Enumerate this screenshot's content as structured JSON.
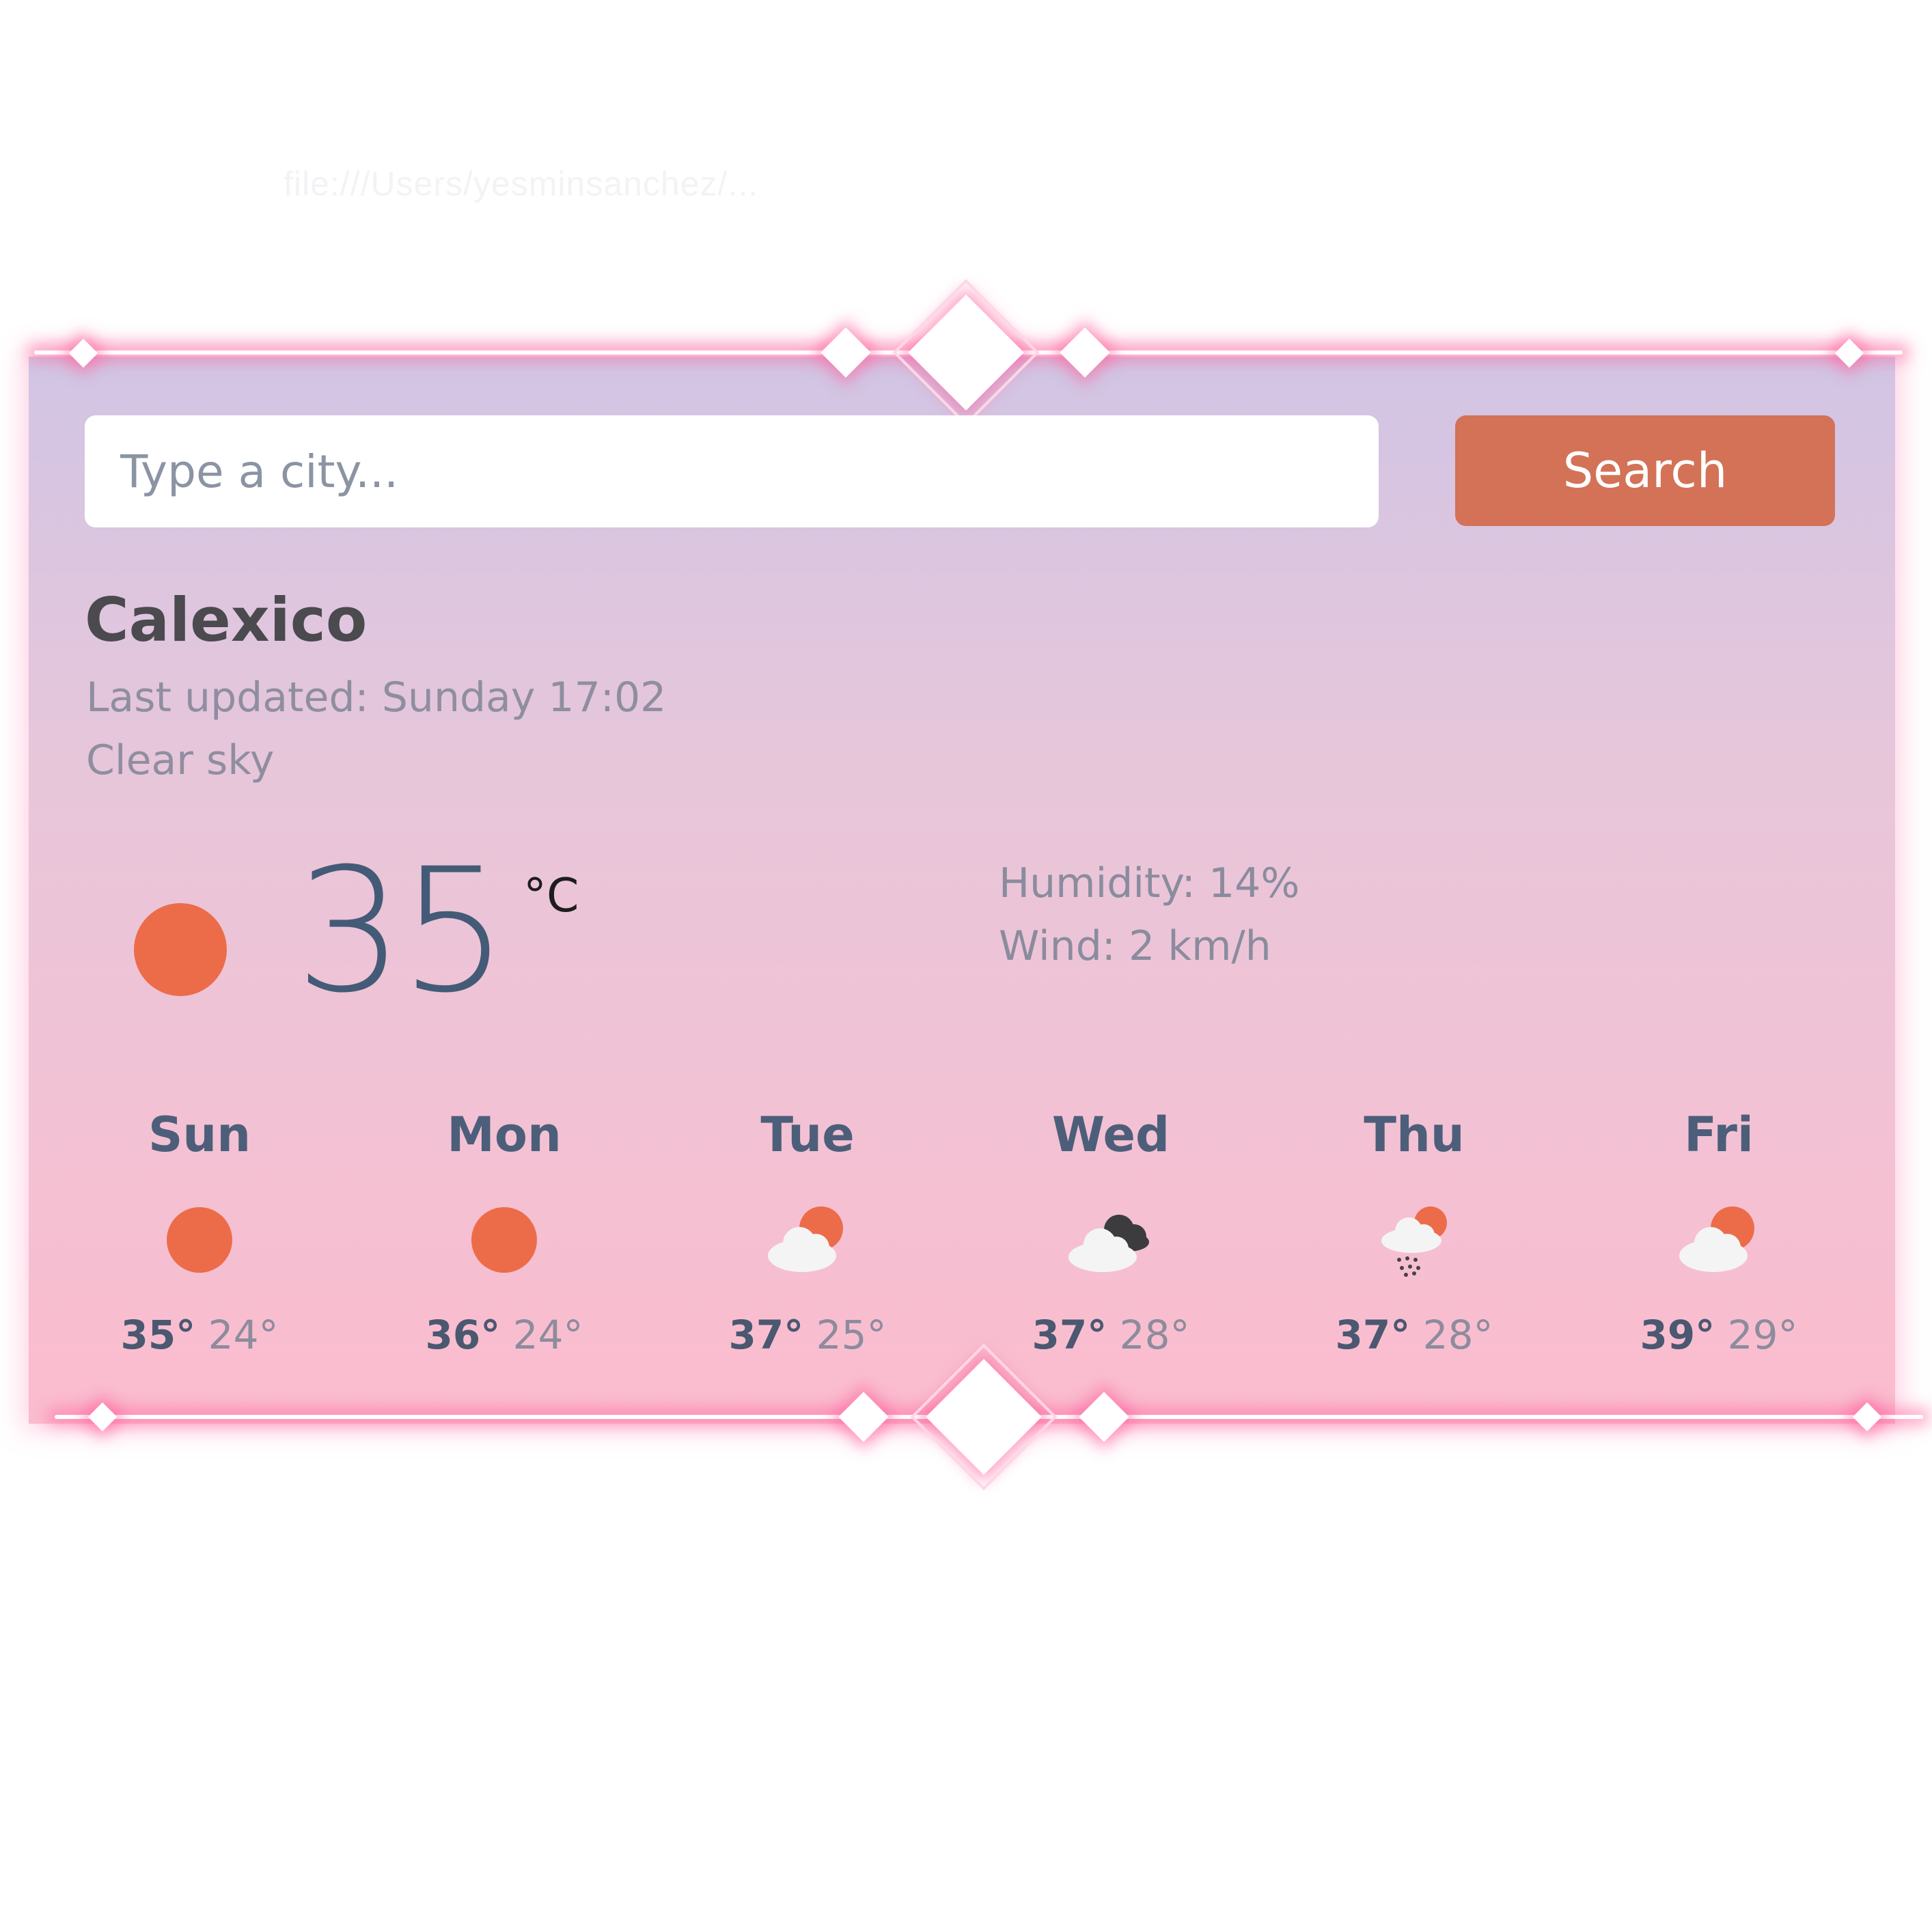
{
  "background_url_text": "file:///Users/yesminsanchez/...",
  "search": {
    "placeholder": "Type a city...",
    "button_label": "Search"
  },
  "current": {
    "city": "Calexico",
    "last_updated": "Last updated: Sunday 17:02",
    "description": "Clear sky",
    "icon": "sun-icon",
    "temperature": "35",
    "unit": "°C",
    "humidity": "Humidity: 14%",
    "wind": "Wind: 2 km/h"
  },
  "forecast": [
    {
      "day": "Sun",
      "icon": "sun-icon",
      "high": "35°",
      "low": "24°"
    },
    {
      "day": "Mon",
      "icon": "sun-icon",
      "high": "36°",
      "low": "24°"
    },
    {
      "day": "Tue",
      "icon": "partly-cloudy-icon",
      "high": "37°",
      "low": "25°"
    },
    {
      "day": "Wed",
      "icon": "dark-clouds-icon",
      "high": "37°",
      "low": "28°"
    },
    {
      "day": "Thu",
      "icon": "rain-sun-icon",
      "high": "37°",
      "low": "28°"
    },
    {
      "day": "Fri",
      "icon": "partly-cloudy-icon",
      "high": "39°",
      "low": "29°"
    }
  ],
  "colors": {
    "accent_button": "#d37257",
    "sun": "#ec6c4a",
    "temperature_text": "#445b77",
    "card_gradient_top": "#d1c5e4",
    "card_gradient_bottom": "#fbbcce",
    "frame_glow": "#ff69a0"
  }
}
